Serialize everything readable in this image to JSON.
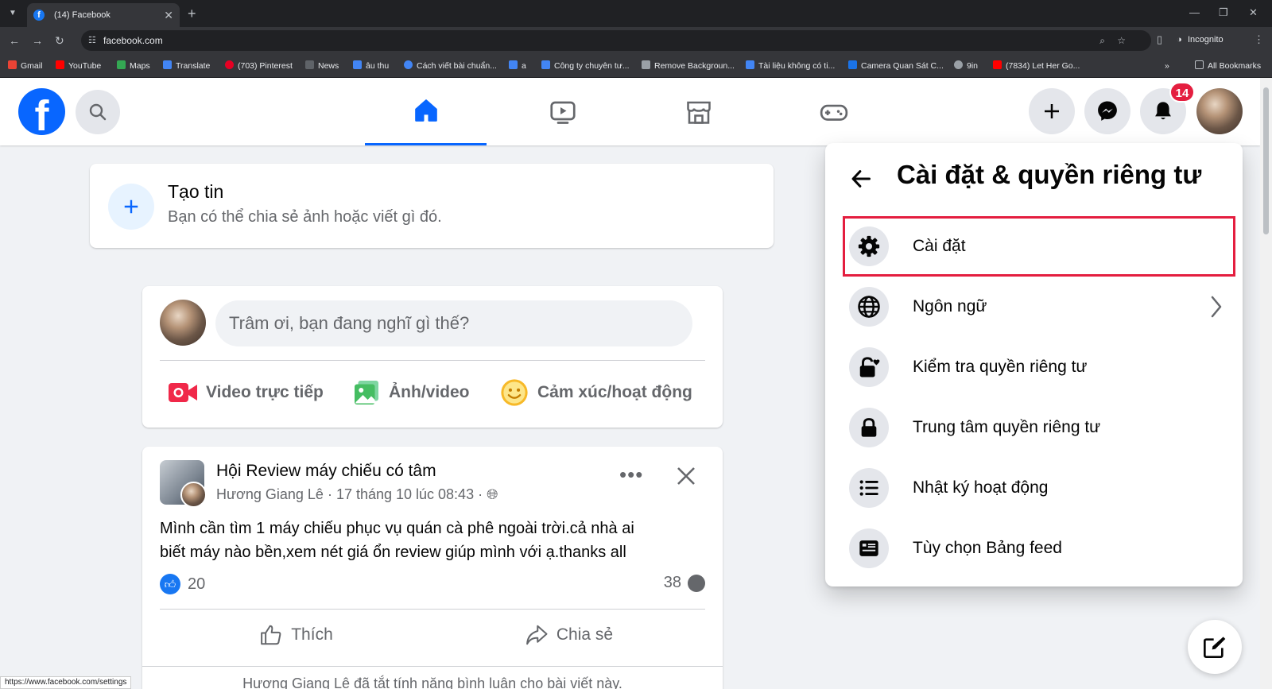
{
  "browser": {
    "tab_title": "(14) Facebook",
    "url": "facebook.com",
    "incognito_label": "Incognito",
    "bookmarks": [
      "Gmail",
      "YouTube",
      "Maps",
      "Translate",
      "(703) Pinterest",
      "News",
      "âu thu",
      "Cách viết bài chuẩn...",
      "a",
      "Công ty chuyên tư...",
      "Remove Backgroun...",
      "Tài liệu không có ti...",
      "Camera Quan Sát C...",
      "9in",
      "(7834) Let Her Go..."
    ],
    "all_bookmarks_label": "All Bookmarks",
    "status_url": "https://www.facebook.com/settings"
  },
  "header": {
    "logo_letter": "f",
    "notifications_count": "14"
  },
  "story": {
    "title": "Tạo tin",
    "subtitle": "Bạn có thể chia sẻ ảnh hoặc viết gì đó."
  },
  "composer": {
    "placeholder": "Trâm ơi, bạn đang nghĩ gì thế?",
    "actions": [
      "Video trực tiếp",
      "Ảnh/video",
      "Cảm xúc/hoạt động"
    ]
  },
  "post": {
    "group": "Hội Review máy chiếu có tâm",
    "author": "Hương Giang Lê",
    "time": "17 tháng 10 lúc 08:43",
    "text_line1": "Mình cần tìm 1 máy chiếu phục vụ quán cà phê ngoài trời.cả nhà ai",
    "text_line2": "biết máy nào bền,xem nét giá ổn review giúp mình với ạ.thanks all",
    "likes": "20",
    "comments": "38",
    "like_label": "Thích",
    "share_label": "Chia sẻ",
    "footer_note": "Hương Giang Lê đã tắt tính năng bình luận cho bài viết này."
  },
  "settings_menu": {
    "title": "Cài đặt & quyền riêng tư",
    "items": [
      "Cài đặt",
      "Ngôn ngữ",
      "Kiểm tra quyền riêng tư",
      "Trung tâm quyền riêng tư",
      "Nhật ký hoạt động",
      "Tùy chọn Bảng feed"
    ]
  },
  "colors": {
    "fb_blue": "#0866ff",
    "highlight_red": "#e41e3f"
  }
}
